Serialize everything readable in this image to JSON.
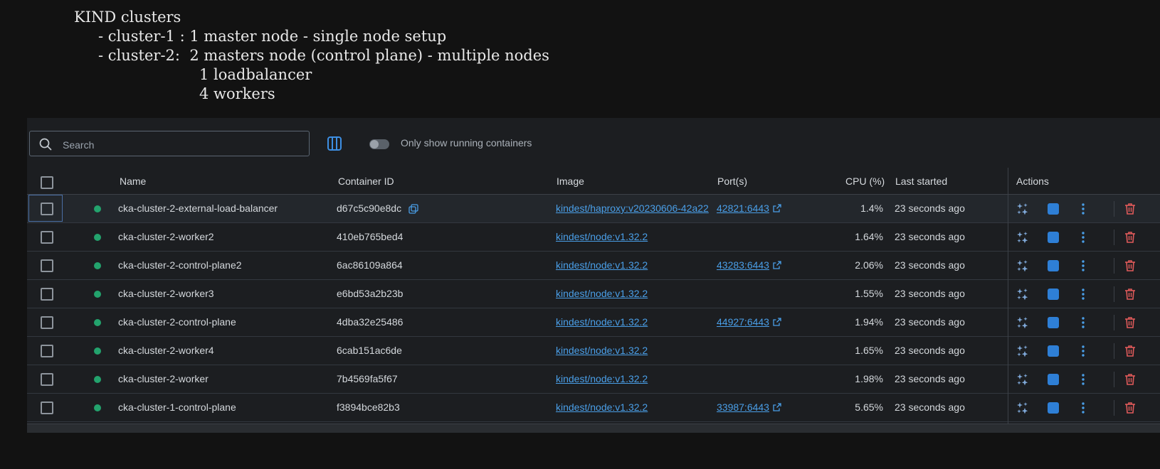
{
  "notes": {
    "line1": "KIND clusters",
    "line2": "- cluster-1 : 1 master node - single node setup",
    "line3": "- cluster-2:  2 masters node (control plane) - multiple nodes",
    "line4": "1 loadbalancer",
    "line5": "4 workers"
  },
  "toolbar": {
    "search_placeholder": "Search",
    "toggle_label": "Only show running containers",
    "toggle_on": false
  },
  "table": {
    "headers": {
      "name": "Name",
      "container_id": "Container ID",
      "image": "Image",
      "ports": "Port(s)",
      "cpu": "CPU (%)",
      "last_started": "Last started",
      "actions": "Actions"
    },
    "rows": [
      {
        "name": "cka-cluster-2-external-load-balancer",
        "id": "d67c5c90e8dc",
        "image": "kindest/haproxy:v20230606-42a22",
        "ports": "42821:6443",
        "cpu": "1.4%",
        "started": "23 seconds ago"
      },
      {
        "name": "cka-cluster-2-worker2",
        "id": "410eb765bed4",
        "image": "kindest/node:v1.32.2",
        "ports": "",
        "cpu": "1.64%",
        "started": "23 seconds ago"
      },
      {
        "name": "cka-cluster-2-control-plane2",
        "id": "6ac86109a864",
        "image": "kindest/node:v1.32.2",
        "ports": "43283:6443",
        "cpu": "2.06%",
        "started": "23 seconds ago"
      },
      {
        "name": "cka-cluster-2-worker3",
        "id": "e6bd53a2b23b",
        "image": "kindest/node:v1.32.2",
        "ports": "",
        "cpu": "1.55%",
        "started": "23 seconds ago"
      },
      {
        "name": "cka-cluster-2-control-plane",
        "id": "4dba32e25486",
        "image": "kindest/node:v1.32.2",
        "ports": "44927:6443",
        "cpu": "1.94%",
        "started": "23 seconds ago"
      },
      {
        "name": "cka-cluster-2-worker4",
        "id": "6cab151ac6de",
        "image": "kindest/node:v1.32.2",
        "ports": "",
        "cpu": "1.65%",
        "started": "23 seconds ago"
      },
      {
        "name": "cka-cluster-2-worker",
        "id": "7b4569fa5f67",
        "image": "kindest/node:v1.32.2",
        "ports": "",
        "cpu": "1.98%",
        "started": "23 seconds ago"
      },
      {
        "name": "cka-cluster-1-control-plane",
        "id": "f3894bce82b3",
        "image": "kindest/node:v1.32.2",
        "ports": "33987:6443",
        "cpu": "5.65%",
        "started": "23 seconds ago"
      }
    ]
  },
  "colors": {
    "background": "#121212",
    "panel": "#1c1e21",
    "status_running": "#23a36d",
    "link": "#4a9fe8",
    "stop_button": "#2e7fd6",
    "delete": "#e05a5a"
  },
  "icons": {
    "search": "search-icon",
    "columns": "columns-icon",
    "copy": "copy-icon",
    "external_link": "external-link-icon",
    "ai": "sparkle-icon",
    "stop": "stop-icon",
    "more": "more-vertical-icon",
    "delete": "trash-icon"
  }
}
